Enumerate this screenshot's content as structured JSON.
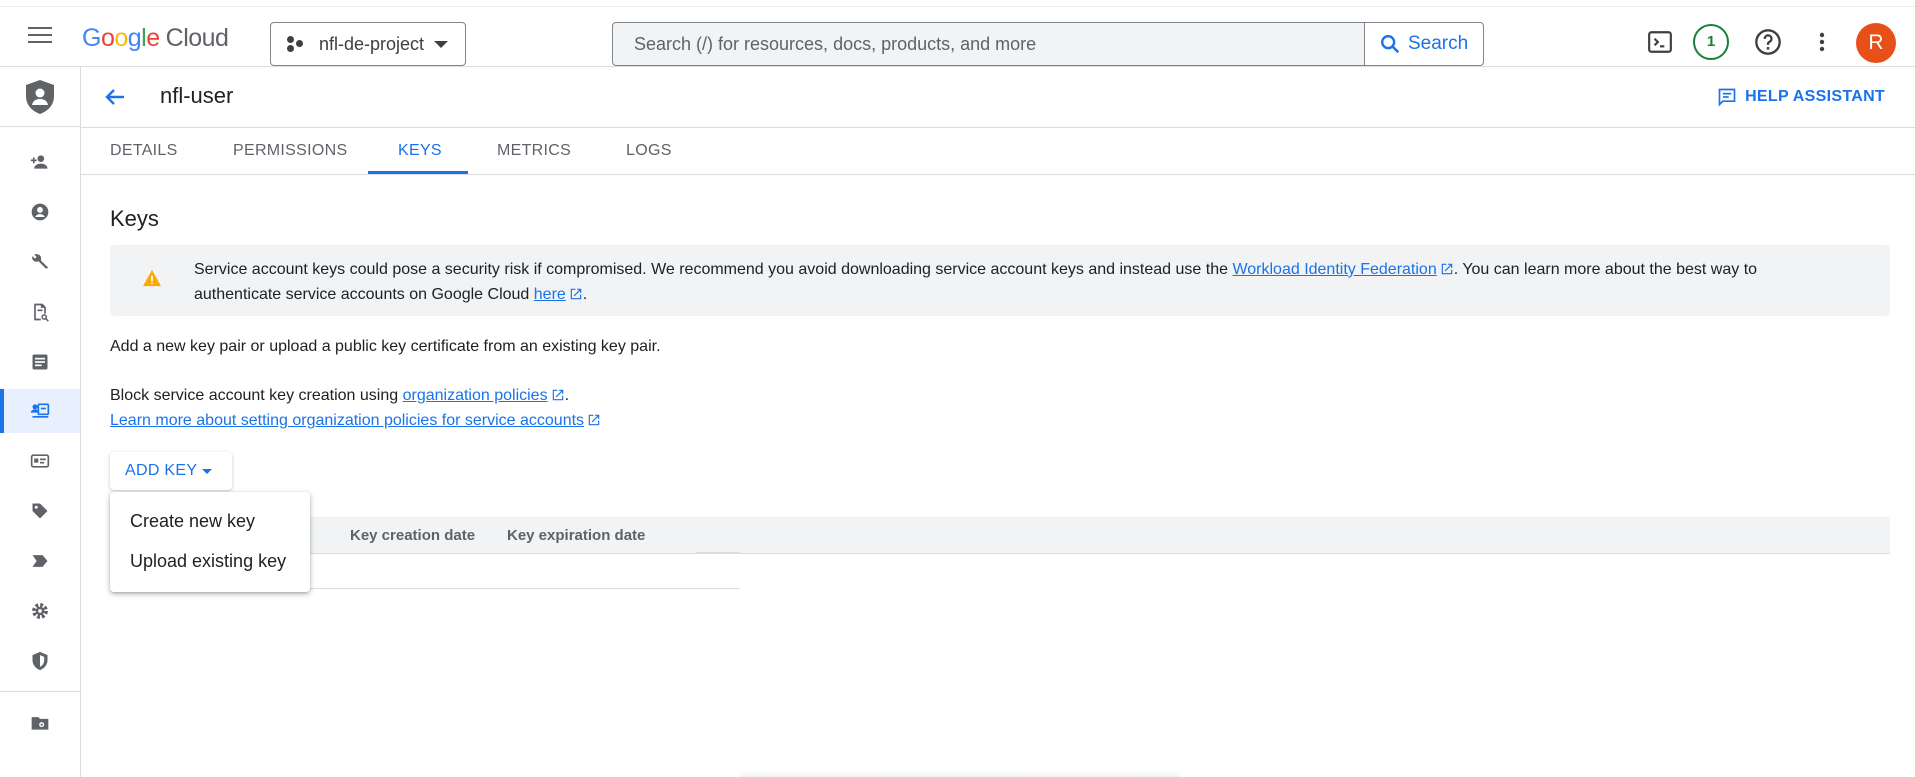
{
  "topbar": {
    "logo": {
      "g1": "G",
      "g2": "o",
      "g3": "o",
      "g4": "g",
      "g5": "l",
      "g6": "e",
      "cloud": "Cloud"
    },
    "project_name": "nfl-de-project",
    "search_placeholder": "Search (/) for resources, docs, products, and more",
    "search_button": "Search",
    "notification_count": "1",
    "avatar_initial": "R"
  },
  "header": {
    "title": "nfl-user",
    "help_label": "HELP ASSISTANT"
  },
  "tabs": [
    "DETAILS",
    "PERMISSIONS",
    "KEYS",
    "METRICS",
    "LOGS"
  ],
  "active_tab": "KEYS",
  "content": {
    "title": "Keys",
    "warning": {
      "text1": "Service account keys could pose a security risk if compromised. We recommend you avoid downloading service account keys and instead use the ",
      "link1": "Workload Identity Federation",
      "text2": ". You can learn more about the best way to authenticate service accounts on Google Cloud ",
      "link2": "here",
      "text3": "."
    },
    "para1": "Add a new key pair or upload a public key certificate from an existing key pair.",
    "para2_text": "Block service account key creation using ",
    "para2_link": "organization policies",
    "para2_end": ".",
    "para3_link": "Learn more about setting organization policies for service accounts",
    "add_key_label": "ADD KEY",
    "dropdown": [
      "Create new key",
      "Upload existing key"
    ],
    "table_headers": [
      "Key creation date",
      "Key expiration date"
    ]
  },
  "colors": {
    "accent": "#1a73e8",
    "warning_icon": "#f9ab00",
    "avatar_bg": "#e8501a",
    "notification": "#188038"
  }
}
